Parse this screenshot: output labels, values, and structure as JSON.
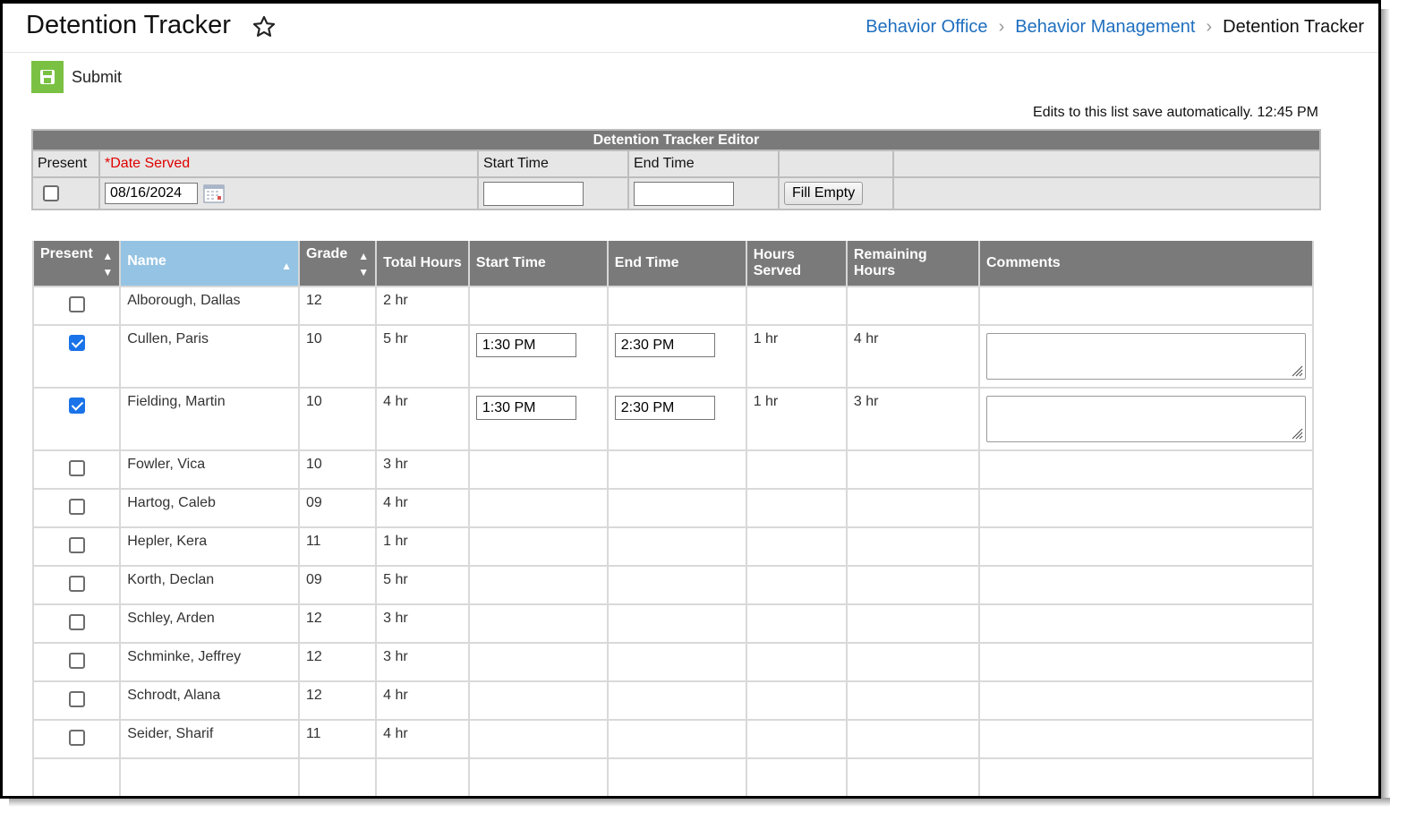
{
  "header": {
    "title": "Detention Tracker",
    "breadcrumb": [
      "Behavior Office",
      "Behavior Management",
      "Detention Tracker"
    ]
  },
  "toolbar": {
    "submit_label": "Submit"
  },
  "autosave": "Edits to this list save automatically. 12:45 PM",
  "editor": {
    "title": "Detention Tracker Editor",
    "present_label": "Present",
    "date_required_mark": "*",
    "date_label": "Date Served",
    "start_label": "Start Time",
    "end_label": "End Time",
    "date_value": "08/16/2024",
    "start_value": "",
    "end_value": "",
    "fill_button": "Fill Empty"
  },
  "grid": {
    "columns": [
      "Present",
      "Name",
      "Grade",
      "Total Hours",
      "Start Time",
      "End Time",
      "Hours Served",
      "Remaining Hours",
      "Comments"
    ],
    "rows": [
      {
        "checked": false,
        "name": "Alborough, Dallas",
        "grade": "12",
        "total": "2 hr",
        "start": "",
        "end": "",
        "served": "",
        "remaining": ""
      },
      {
        "checked": true,
        "name": "Cullen, Paris",
        "grade": "10",
        "total": "5 hr",
        "start": "1:30 PM",
        "end": "2:30 PM",
        "served": "1 hr",
        "remaining": "4 hr"
      },
      {
        "checked": true,
        "name": "Fielding, Martin",
        "grade": "10",
        "total": "4 hr",
        "start": "1:30 PM",
        "end": "2:30 PM",
        "served": "1 hr",
        "remaining": "3 hr"
      },
      {
        "checked": false,
        "name": "Fowler, Vica",
        "grade": "10",
        "total": "3 hr",
        "start": "",
        "end": "",
        "served": "",
        "remaining": ""
      },
      {
        "checked": false,
        "name": "Hartog, Caleb",
        "grade": "09",
        "total": "4 hr",
        "start": "",
        "end": "",
        "served": "",
        "remaining": ""
      },
      {
        "checked": false,
        "name": "Hepler, Kera",
        "grade": "11",
        "total": "1 hr",
        "start": "",
        "end": "",
        "served": "",
        "remaining": ""
      },
      {
        "checked": false,
        "name": "Korth, Declan",
        "grade": "09",
        "total": "5 hr",
        "start": "",
        "end": "",
        "served": "",
        "remaining": ""
      },
      {
        "checked": false,
        "name": "Schley, Arden",
        "grade": "12",
        "total": "3 hr",
        "start": "",
        "end": "",
        "served": "",
        "remaining": ""
      },
      {
        "checked": false,
        "name": "Schminke, Jeffrey",
        "grade": "12",
        "total": "3 hr",
        "start": "",
        "end": "",
        "served": "",
        "remaining": ""
      },
      {
        "checked": false,
        "name": "Schrodt, Alana",
        "grade": "12",
        "total": "4 hr",
        "start": "",
        "end": "",
        "served": "",
        "remaining": ""
      },
      {
        "checked": false,
        "name": "Seider, Sharif",
        "grade": "11",
        "total": "4 hr",
        "start": "",
        "end": "",
        "served": "",
        "remaining": ""
      }
    ]
  },
  "colors": {
    "link": "#1f6fbf",
    "header_bg": "#7a7a7a",
    "sorted_header_bg": "#95c3e3",
    "submit_green": "#7ac143",
    "checkbox_blue": "#1a73e8"
  },
  "icons": {
    "favorite": "star-outline-icon",
    "submit": "save-disk-icon",
    "calendar": "calendar-icon",
    "sort": "sort-arrows-icon"
  }
}
